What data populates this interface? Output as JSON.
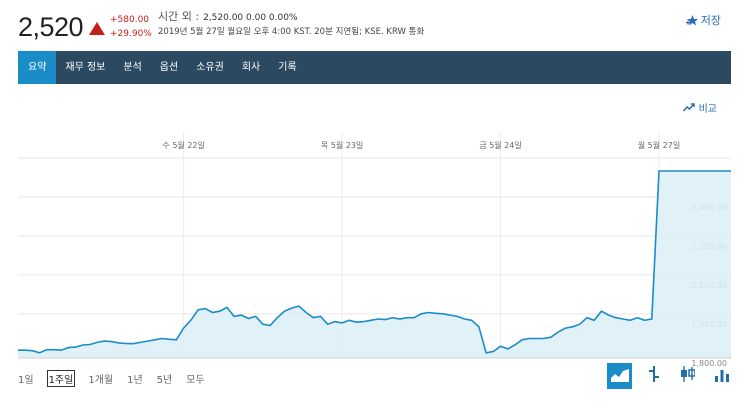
{
  "quote": {
    "price": "2,520",
    "change": "+580.00",
    "change_pct": "+29.90%",
    "after_hours_label": "시간 외 :",
    "after_hours_values": "2,520.00  0.00  0.00%",
    "timestamp_line": "2019년 5월 27일 월요일 오후 4:00 KST. 20분 지연됨; KSE. KRW 통화",
    "up_color": "#c5211b"
  },
  "header": {
    "save_label": "저장"
  },
  "tabs": [
    {
      "label": "요약",
      "active": true
    },
    {
      "label": "재무 정보"
    },
    {
      "label": "분석"
    },
    {
      "label": "옵션"
    },
    {
      "label": "소유권"
    },
    {
      "label": "회사"
    },
    {
      "label": "기록"
    }
  ],
  "compare_label": "비교",
  "chart_data": {
    "type": "area",
    "x_tick_labels": [
      "수 5월 22일",
      "목 5월 23일",
      "금 5월 24일",
      "월 5월 27일"
    ],
    "y_tick_labels": [
      "2,400.00",
      "2,250.00",
      "2,100.00",
      "1,950.00",
      "1,800.00"
    ],
    "y_ticks": [
      2400,
      2250,
      2100,
      1950,
      1800
    ],
    "ylim": [
      1780,
      2550
    ],
    "grid": true,
    "x": [
      0,
      1,
      2,
      3,
      4,
      5,
      6,
      7,
      8,
      9,
      10,
      11,
      12,
      13,
      14,
      15,
      16,
      17,
      18,
      19,
      20,
      21,
      22,
      23,
      24,
      25,
      26,
      27,
      28,
      29,
      30,
      31,
      32,
      33,
      34,
      35,
      36,
      37,
      38,
      39,
      40,
      41,
      42,
      43,
      44,
      45,
      46,
      47,
      48,
      49,
      50,
      51,
      52,
      53,
      54,
      55,
      56,
      57,
      58,
      59,
      60,
      61,
      62,
      63,
      64,
      65,
      66,
      67,
      68,
      69,
      70,
      71,
      72,
      73,
      74,
      75,
      76,
      77,
      78,
      79,
      80,
      81,
      82,
      83,
      84,
      85,
      86,
      87,
      88,
      89,
      90,
      91,
      92,
      93,
      94,
      95,
      96,
      97,
      98,
      99
    ],
    "values": [
      1810,
      1810,
      1808,
      1800,
      1812,
      1812,
      1810,
      1820,
      1822,
      1830,
      1832,
      1840,
      1845,
      1843,
      1838,
      1836,
      1835,
      1840,
      1845,
      1850,
      1855,
      1852,
      1850,
      1895,
      1925,
      1965,
      1970,
      1955,
      1960,
      1975,
      1940,
      1945,
      1932,
      1940,
      1910,
      1905,
      1935,
      1960,
      1972,
      1980,
      1955,
      1935,
      1940,
      1910,
      1920,
      1915,
      1925,
      1918,
      1920,
      1925,
      1930,
      1928,
      1935,
      1930,
      1935,
      1935,
      1950,
      1955,
      1952,
      1950,
      1945,
      1940,
      1930,
      1925,
      1900,
      1800,
      1805,
      1825,
      1815,
      1830,
      1850,
      1855,
      1855,
      1855,
      1860,
      1880,
      1895,
      1900,
      1910,
      1935,
      1925,
      1960,
      1945,
      1935,
      1930,
      1925,
      1935,
      1925,
      1930,
      2500,
      2500,
      2500,
      2500,
      2500,
      2500,
      2500,
      2500,
      2500,
      2500,
      2500
    ],
    "line_color": "#1a8cc8",
    "fill_color": "#dceef7"
  },
  "ranges": [
    {
      "label": "1일"
    },
    {
      "label": "1주일",
      "active": true
    },
    {
      "label": "1개월"
    },
    {
      "label": "1년"
    },
    {
      "label": "5년"
    },
    {
      "label": "모두"
    }
  ],
  "chart_types": [
    {
      "name": "mountain-chart-icon",
      "active": true
    },
    {
      "name": "ohlc-chart-icon"
    },
    {
      "name": "candlestick-chart-icon"
    },
    {
      "name": "bar-volume-chart-icon"
    }
  ]
}
